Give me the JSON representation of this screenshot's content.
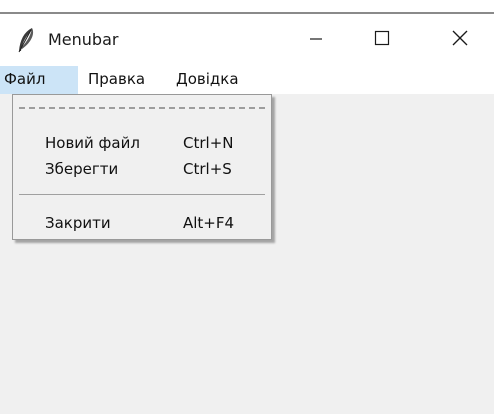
{
  "window": {
    "title": "Menubar",
    "icon": "feather-icon",
    "controls": {
      "minimize": "minimize-icon",
      "maximize": "maximize-icon",
      "close": "close-icon"
    }
  },
  "menubar": {
    "items": [
      {
        "label": "Файл",
        "active": true
      },
      {
        "label": "Правка",
        "active": false
      },
      {
        "label": "Довідка",
        "active": false
      }
    ]
  },
  "file_menu": {
    "items": [
      {
        "label": "Новий файл",
        "accelerator": "Ctrl+N"
      },
      {
        "label": "Зберегти",
        "accelerator": "Ctrl+S"
      },
      {
        "label": "Закрити",
        "accelerator": "Alt+F4"
      }
    ]
  },
  "colors": {
    "active_menu_bg": "#cce4f7",
    "client_bg": "#f0f0f0",
    "dropdown_bg": "#f0f0f0"
  }
}
